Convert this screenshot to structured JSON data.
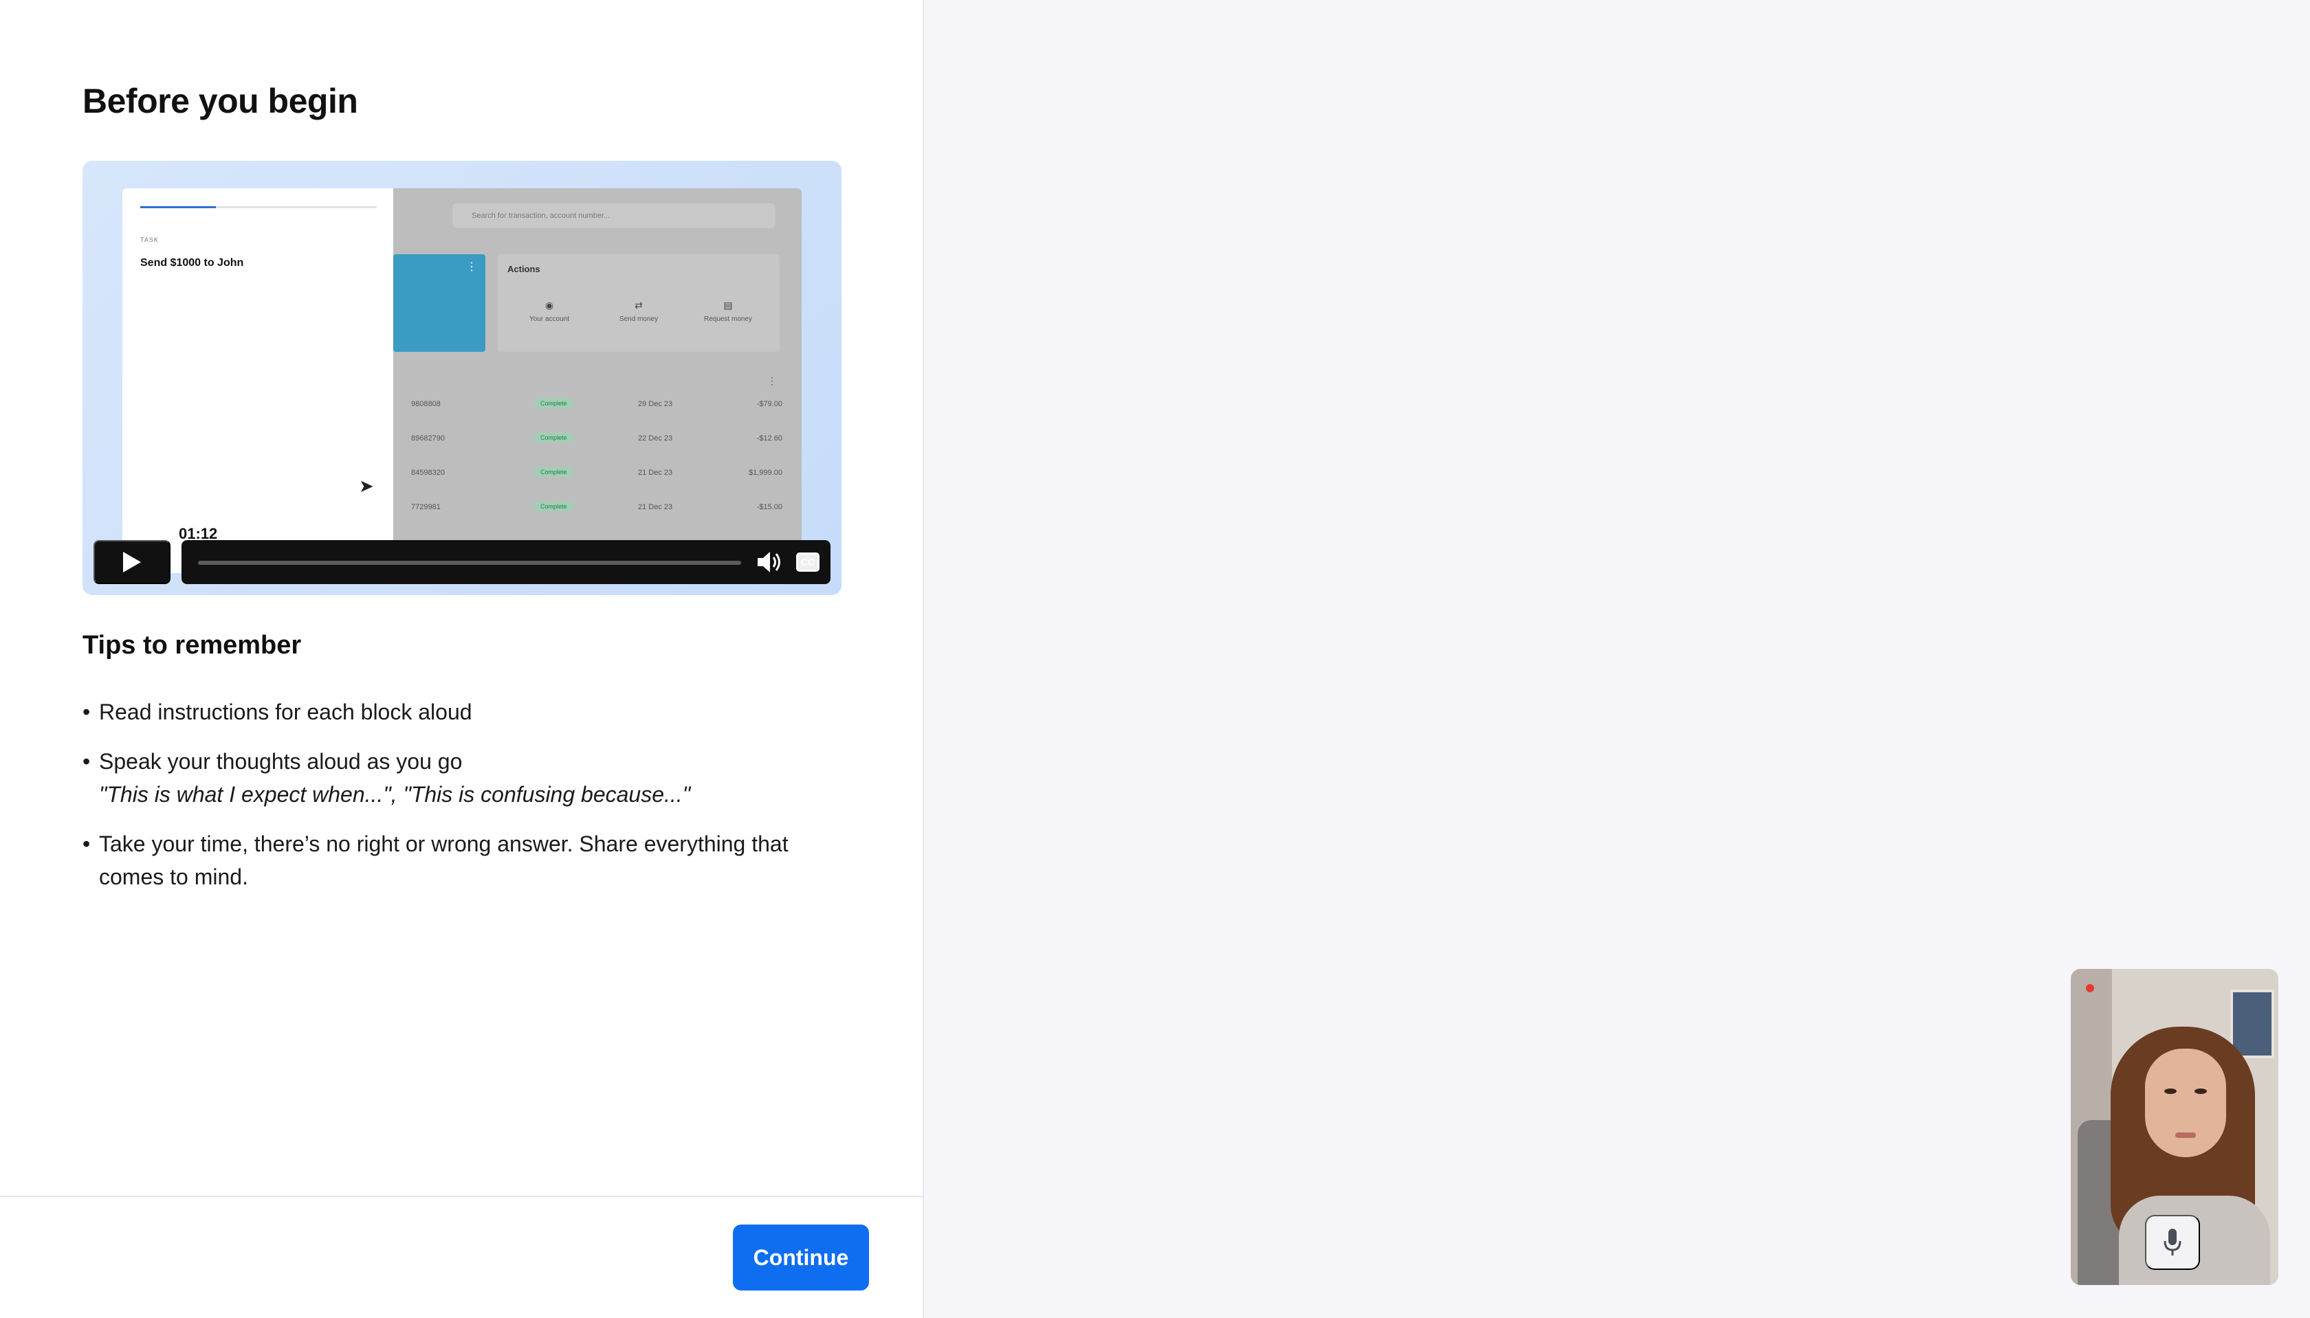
{
  "page": {
    "title": "Before you begin"
  },
  "video": {
    "preview": {
      "search_placeholder": "Search for transaction, account number...",
      "task_label": "TASK",
      "task_text": "Send $1000 to John",
      "actions_title": "Actions",
      "actions": [
        {
          "label": "Your account",
          "icon": "user-icon"
        },
        {
          "label": "Send money",
          "icon": "send-icon"
        },
        {
          "label": "Request money",
          "icon": "request-icon"
        }
      ],
      "transactions": [
        {
          "id": "9808808",
          "status": "Complete",
          "date": "29 Dec 23",
          "amount": "-$79.00"
        },
        {
          "id": "89682790",
          "status": "Complete",
          "date": "22 Dec 23",
          "amount": "-$12.60"
        },
        {
          "id": "84598320",
          "status": "Complete",
          "date": "21 Dec 23",
          "amount": "$1,999.00"
        },
        {
          "id": "7729981",
          "status": "Complete",
          "date": "21 Dec 23",
          "amount": "-$15.00"
        }
      ]
    },
    "controls": {
      "time": "01:12",
      "play_icon": "play-icon",
      "volume_icon": "volume-icon",
      "cc_label": "CC"
    }
  },
  "tips": {
    "title": "Tips to remember",
    "items": [
      {
        "text": "Read instructions for each block aloud"
      },
      {
        "text": "Speak your thoughts aloud as you go",
        "quote": "\"This is what I expect when...\", \"This is confusing because...\""
      },
      {
        "text": "Take your time, there’s no right or wrong answer. Share everything that comes to mind."
      }
    ]
  },
  "footer": {
    "continue_label": "Continue"
  },
  "webcam": {
    "mic_icon": "microphone-icon",
    "recording_indicator": "recording-dot"
  },
  "colors": {
    "primary": "#0f6ef0",
    "background": "#f6f6fa",
    "record": "#e53935"
  }
}
